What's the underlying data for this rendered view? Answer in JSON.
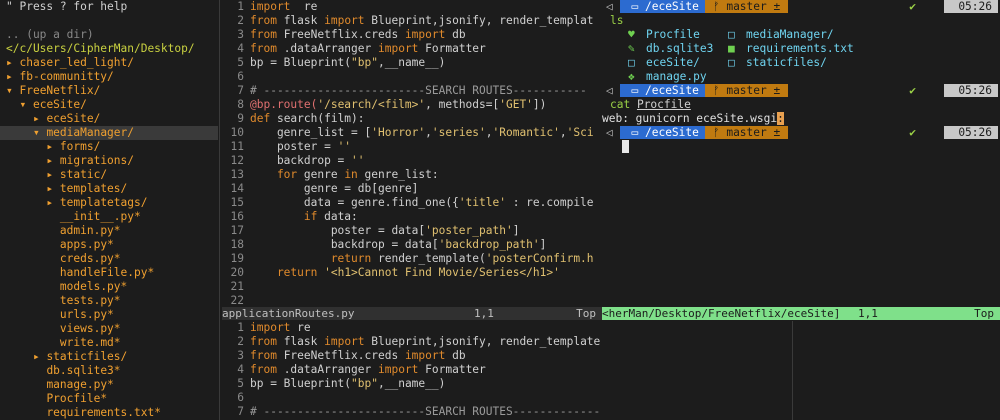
{
  "tree": {
    "help": "\" Press ? for help",
    "up": ".. (up a dir)",
    "root": "</c/Users/CipherMan/Desktop/",
    "items": [
      {
        "indent": 0,
        "kind": "dir",
        "open": false,
        "label": "chaser_led_light/"
      },
      {
        "indent": 0,
        "kind": "dir",
        "open": false,
        "label": "fb-communitty/"
      },
      {
        "indent": 0,
        "kind": "dir",
        "open": true,
        "label": "FreeNetflix/"
      },
      {
        "indent": 1,
        "kind": "dir",
        "open": true,
        "label": "eceSite/"
      },
      {
        "indent": 2,
        "kind": "dir",
        "open": false,
        "label": "eceSite/"
      },
      {
        "indent": 2,
        "kind": "dir",
        "open": true,
        "label": "mediaManager/",
        "selected": true
      },
      {
        "indent": 3,
        "kind": "dir",
        "open": false,
        "label": "forms/"
      },
      {
        "indent": 3,
        "kind": "dir",
        "open": false,
        "label": "migrations/"
      },
      {
        "indent": 3,
        "kind": "dir",
        "open": false,
        "label": "static/"
      },
      {
        "indent": 3,
        "kind": "dir",
        "open": false,
        "label": "templates/"
      },
      {
        "indent": 3,
        "kind": "dir",
        "open": false,
        "label": "templatetags/"
      },
      {
        "indent": 3,
        "kind": "file",
        "label": "__init__.py*"
      },
      {
        "indent": 3,
        "kind": "file",
        "label": "admin.py*"
      },
      {
        "indent": 3,
        "kind": "file",
        "label": "apps.py*"
      },
      {
        "indent": 3,
        "kind": "file",
        "label": "creds.py*"
      },
      {
        "indent": 3,
        "kind": "file",
        "label": "handleFile.py*"
      },
      {
        "indent": 3,
        "kind": "file",
        "label": "models.py*"
      },
      {
        "indent": 3,
        "kind": "file",
        "label": "tests.py*"
      },
      {
        "indent": 3,
        "kind": "file",
        "label": "urls.py*"
      },
      {
        "indent": 3,
        "kind": "file",
        "label": "views.py*"
      },
      {
        "indent": 3,
        "kind": "file",
        "label": "write.md*"
      },
      {
        "indent": 2,
        "kind": "dir",
        "open": false,
        "label": "staticfiles/"
      },
      {
        "indent": 2,
        "kind": "file",
        "label": "db.sqlite3*"
      },
      {
        "indent": 2,
        "kind": "file",
        "label": "manage.py*"
      },
      {
        "indent": 2,
        "kind": "file",
        "label": "Procfile*"
      },
      {
        "indent": 2,
        "kind": "file",
        "label": "requirements.txt*"
      }
    ]
  },
  "editor_top": {
    "lines": [
      {
        "n": "1",
        "code": [
          [
            "kw",
            "import"
          ],
          [
            "",
            "  re"
          ]
        ]
      },
      {
        "n": "2",
        "code": [
          [
            "kw",
            "from"
          ],
          [
            "",
            " flask "
          ],
          [
            "kw",
            "import"
          ],
          [
            "",
            " Blueprint,jsonify, render_templat"
          ]
        ]
      },
      {
        "n": "3",
        "code": [
          [
            "kw",
            "from"
          ],
          [
            "",
            " FreeNetflix.creds "
          ],
          [
            "kw",
            "import"
          ],
          [
            "",
            " db"
          ]
        ]
      },
      {
        "n": "4",
        "code": [
          [
            "kw",
            "from"
          ],
          [
            "",
            " .dataArranger "
          ],
          [
            "kw",
            "import"
          ],
          [
            "",
            " Formatter"
          ]
        ]
      },
      {
        "n": "5",
        "code": [
          [
            "",
            "bp = Blueprint("
          ],
          [
            "str",
            "\"bp\""
          ],
          [
            "",
            ",__name__)"
          ]
        ]
      },
      {
        "n": "6",
        "code": []
      },
      {
        "n": "7",
        "code": [
          [
            "cm",
            "# ------------------------SEARCH ROUTES-----------"
          ]
        ]
      },
      {
        "n": "8",
        "code": [
          [
            "dec",
            "@bp.route("
          ],
          [
            "str",
            "'/search/<film>'"
          ],
          [
            "",
            ", methods=["
          ],
          [
            "str",
            "'GET'"
          ],
          [
            "",
            "])"
          ]
        ]
      },
      {
        "n": "9",
        "code": [
          [
            "kw",
            "def"
          ],
          [
            "",
            " search(film):"
          ]
        ]
      },
      {
        "n": "10",
        "code": [
          [
            "",
            "    genre_list = ["
          ],
          [
            "str",
            "'Horror'"
          ],
          [
            "",
            ","
          ],
          [
            "str",
            "'series'"
          ],
          [
            "",
            ","
          ],
          [
            "str",
            "'Romantic'"
          ],
          [
            "",
            ","
          ],
          [
            "str",
            "'Sci"
          ]
        ]
      },
      {
        "n": "11",
        "code": [
          [
            "",
            "    poster = "
          ],
          [
            "str",
            "''"
          ]
        ]
      },
      {
        "n": "12",
        "code": [
          [
            "",
            "    backdrop = "
          ],
          [
            "str",
            "''"
          ]
        ]
      },
      {
        "n": "13",
        "code": [
          [
            "kw",
            "    for"
          ],
          [
            "",
            " genre "
          ],
          [
            "kw",
            "in"
          ],
          [
            "",
            " genre_list:"
          ]
        ]
      },
      {
        "n": "14",
        "code": [
          [
            "",
            "        genre = db[genre]"
          ]
        ]
      },
      {
        "n": "15",
        "code": [
          [
            "",
            "        data = genre.find_one({"
          ],
          [
            "str",
            "'title'"
          ],
          [
            "",
            " : re.compile"
          ]
        ]
      },
      {
        "n": "16",
        "code": [
          [
            "kw",
            "        if"
          ],
          [
            "",
            " data:"
          ]
        ]
      },
      {
        "n": "17",
        "code": [
          [
            "",
            "            poster = data["
          ],
          [
            "str",
            "'poster_path'"
          ],
          [
            "",
            "]"
          ]
        ]
      },
      {
        "n": "18",
        "code": [
          [
            "",
            "            backdrop = data["
          ],
          [
            "str",
            "'backdrop_path'"
          ],
          [
            "",
            "]"
          ]
        ]
      },
      {
        "n": "19",
        "code": [
          [
            "kw",
            "            return"
          ],
          [
            "",
            " render_template("
          ],
          [
            "str",
            "'posterConfirm.h"
          ]
        ]
      },
      {
        "n": "20",
        "code": [
          [
            "kw",
            "    return"
          ],
          [
            "",
            " "
          ],
          [
            "str",
            "'<h1>Cannot Find Movie/Series</h1>'"
          ]
        ]
      },
      {
        "n": "21",
        "code": []
      },
      {
        "n": "22",
        "code": []
      }
    ]
  },
  "status_left": {
    "file": "applicationRoutes.py",
    "pos": "1,1",
    "where": "Top"
  },
  "status_right": {
    "path": "<herMan/Desktop/FreeNetflix/eceSite]",
    "pos": "1,1",
    "where": "Top"
  },
  "editor_bot": {
    "lines": [
      {
        "n": "1",
        "code": [
          [
            "kw",
            "import"
          ],
          [
            "",
            " re"
          ]
        ]
      },
      {
        "n": "2",
        "code": [
          [
            "kw",
            "from"
          ],
          [
            "",
            " flask "
          ],
          [
            "kw",
            "import"
          ],
          [
            "",
            " Blueprint,jsonify, render_template"
          ]
        ]
      },
      {
        "n": "3",
        "code": [
          [
            "kw",
            "from"
          ],
          [
            "",
            " FreeNetflix.creds "
          ],
          [
            "kw",
            "import"
          ],
          [
            "",
            " db"
          ]
        ]
      },
      {
        "n": "4",
        "code": [
          [
            "kw",
            "from"
          ],
          [
            "",
            " .dataArranger "
          ],
          [
            "kw",
            "import"
          ],
          [
            "",
            " Formatter"
          ]
        ]
      },
      {
        "n": "5",
        "code": [
          [
            "",
            "bp = Blueprint("
          ],
          [
            "str",
            "\"bp\""
          ],
          [
            "",
            ",__name__)"
          ]
        ]
      },
      {
        "n": "6",
        "code": []
      },
      {
        "n": "7",
        "code": [
          [
            "cm",
            "# ------------------------SEARCH ROUTES----------------------------------"
          ]
        ]
      }
    ]
  },
  "terminal": {
    "prompt_dir": "/eceSite",
    "prompt_git": "master ±",
    "check": "✔",
    "time": "05:26",
    "cmd1": "ls",
    "ls": [
      {
        "icon": "♥",
        "color": "green",
        "name": "Procfile"
      },
      {
        "icon": "□",
        "color": "blue",
        "name": "mediaManager/"
      },
      {
        "icon": "✎",
        "color": "green",
        "name": "db.sqlite3"
      },
      {
        "icon": "■",
        "color": "green",
        "name": "requirements.txt"
      },
      {
        "icon": "□",
        "color": "blue",
        "name": "eceSite/"
      },
      {
        "icon": "□",
        "color": "blue",
        "name": "staticfiles/"
      },
      {
        "icon": "❖",
        "color": "green",
        "name": "manage.py"
      }
    ],
    "cmd2_prefix": "cat ",
    "cmd2_arg": "Procfile",
    "output": "web: gunicorn eceSite.wsgi",
    "output_cursor": ":"
  }
}
